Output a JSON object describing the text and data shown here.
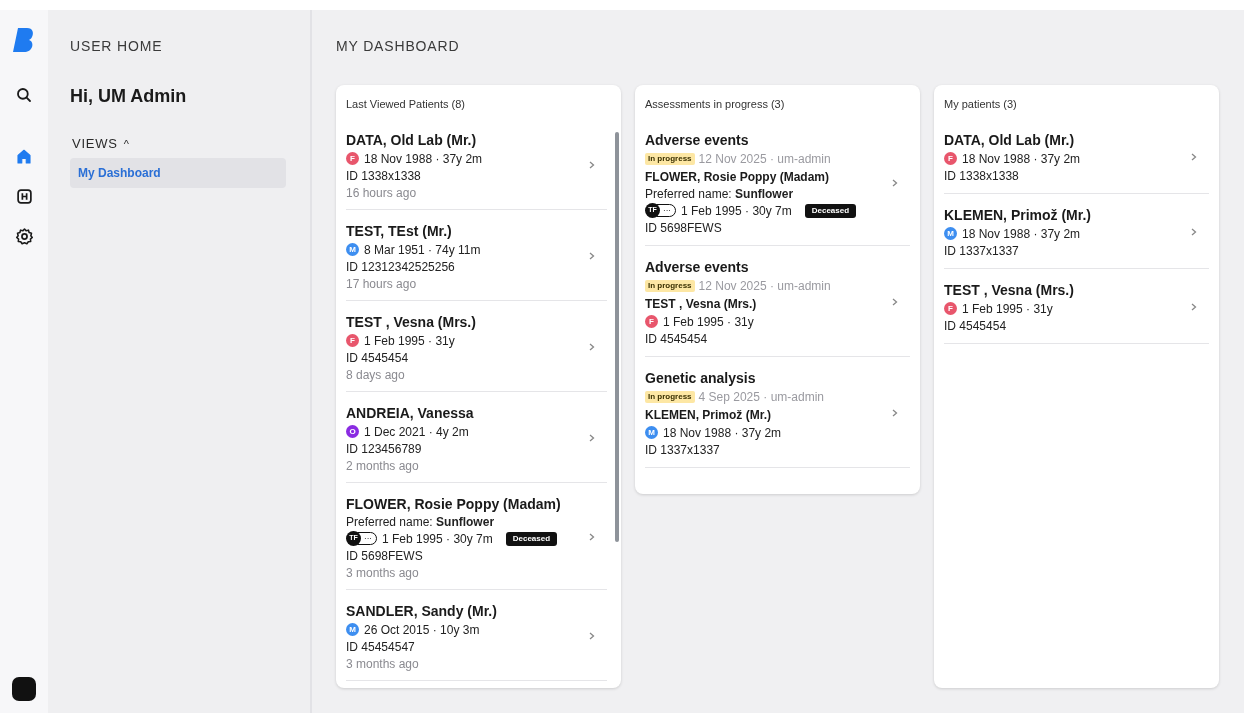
{
  "rail": {
    "items": [
      {
        "kind": "search",
        "selected": false
      },
      {
        "kind": "home",
        "selected": true
      },
      {
        "kind": "hospital",
        "selected": false
      },
      {
        "kind": "settings",
        "selected": false
      }
    ]
  },
  "sidebar": {
    "title": "USER HOME",
    "greeting": "Hi, UM Admin",
    "section": {
      "label": "VIEWS",
      "caret": "^",
      "expanded": true,
      "items": [
        {
          "label": "My Dashboard",
          "selected": true
        }
      ]
    }
  },
  "page_title": "MY DASHBOARD",
  "cards": [
    {
      "kind": "patients",
      "title": "Last Viewed Patients (8)",
      "scrollable": true,
      "rows": [
        {
          "name": "DATA, Old Lab (Mr.)",
          "badge": {
            "kind": "sex",
            "text": "F",
            "color": "#e8566c"
          },
          "dob": "18 Nov 1988 · 37y 2m",
          "id": "ID 1338x1338",
          "viewed": "16 hours ago"
        },
        {
          "name": "TEST, TEst (Mr.)",
          "badge": {
            "kind": "sex",
            "text": "M",
            "color": "#3d8ef0"
          },
          "dob": "8 Mar 1951 · 74y 11m",
          "id": "ID 12312342525256",
          "viewed": "17 hours ago"
        },
        {
          "name": "TEST , Vesna (Mrs.)",
          "badge": {
            "kind": "sex",
            "text": "F",
            "color": "#e8566c"
          },
          "dob": "1 Feb 1995 · 31y",
          "id": "ID 4545454",
          "viewed": "8 days ago"
        },
        {
          "name": "ANDREIA, Vanessa",
          "badge": {
            "kind": "sex",
            "text": "O",
            "color": "#8a2be2"
          },
          "dob": "1 Dec 2021 · 4y 2m",
          "id": "ID 123456789",
          "viewed": "2 months ago"
        },
        {
          "name": "FLOWER, Rosie Poppy (Madam)",
          "preferred": "Preferred name: **Sunflower**",
          "badge": {
            "kind": "initials",
            "text": "TF",
            "more": "···"
          },
          "dob": "1 Feb 1995 · 30y 7m",
          "tag": "Deceased",
          "id": "ID 5698FEWS",
          "viewed": "3 months ago"
        },
        {
          "name": "SANDLER, Sandy (Mr.)",
          "badge": {
            "kind": "sex",
            "text": "M",
            "color": "#3d8ef0"
          },
          "dob": "26 Oct 2015 · 10y 3m",
          "id": "ID 45454547",
          "viewed": "3 months ago"
        }
      ]
    },
    {
      "kind": "assessments",
      "title": "Assessments in progress (3)",
      "scrollable": false,
      "rows": [
        {
          "title": "Adverse events",
          "status": "In progress",
          "meta": "12 Nov 2025 · um-admin",
          "name": "FLOWER, Rosie Poppy (Madam)",
          "preferred": "Preferred name: **Sunflower**",
          "badge": {
            "kind": "initials",
            "text": "TF",
            "more": "···"
          },
          "dob": "1 Feb 1995 · 30y 7m",
          "tag": "Deceased",
          "id": "ID 5698FEWS"
        },
        {
          "title": "Adverse events",
          "status": "In progress",
          "meta": "12 Nov 2025 · um-admin",
          "name": "TEST , Vesna (Mrs.)",
          "badge": {
            "kind": "sex",
            "text": "F",
            "color": "#e8566c"
          },
          "dob": "1 Feb 1995 · 31y",
          "id": "ID 4545454"
        },
        {
          "title": "Genetic analysis",
          "status": "In progress",
          "meta": "4 Sep 2025 · um-admin",
          "name": "KLEMEN, Primož (Mr.)",
          "badge": {
            "kind": "sex",
            "text": "M",
            "color": "#3d8ef0"
          },
          "dob": "18 Nov 1988 · 37y 2m",
          "id": "ID 1337x1337"
        }
      ]
    },
    {
      "kind": "patients",
      "title": "My patients (3)",
      "scrollable": false,
      "rows": [
        {
          "name": "DATA, Old Lab (Mr.)",
          "badge": {
            "kind": "sex",
            "text": "F",
            "color": "#e8566c"
          },
          "dob": "18 Nov 1988 · 37y 2m",
          "id": "ID 1338x1338"
        },
        {
          "name": "KLEMEN, Primož (Mr.)",
          "badge": {
            "kind": "sex",
            "text": "M",
            "color": "#3d8ef0"
          },
          "dob": "18 Nov 1988 · 37y 2m",
          "id": "ID 1337x1337"
        },
        {
          "name": "TEST , Vesna (Mrs.)",
          "badge": {
            "kind": "sex",
            "text": "F",
            "color": "#e8566c"
          },
          "dob": "1 Feb 1995 · 31y",
          "id": "ID 4545454"
        }
      ]
    }
  ]
}
